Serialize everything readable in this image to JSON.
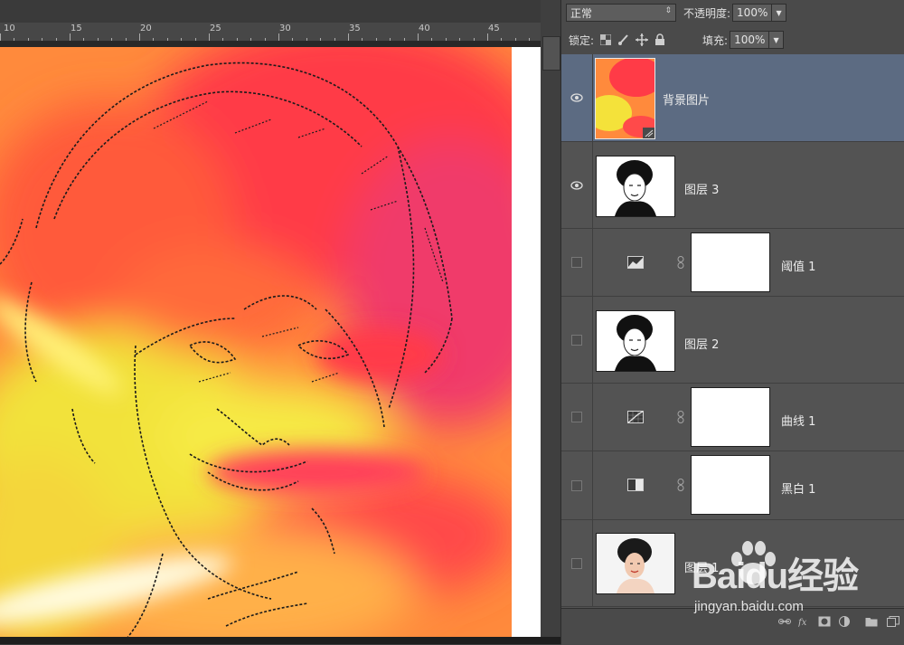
{
  "canvas": {
    "ruler_numbers": [
      "10",
      "15",
      "20",
      "25",
      "30",
      "35",
      "40",
      "45"
    ]
  },
  "layers_panel": {
    "blend_mode": "正常",
    "opacity_label": "不透明度:",
    "opacity_value": "100%",
    "lock_label": "锁定:",
    "fill_label": "填充:",
    "fill_value": "100%",
    "layers": [
      {
        "name": "背景图片",
        "visible": true,
        "selected": true,
        "kind": "image"
      },
      {
        "name": "图层 3",
        "visible": true,
        "selected": false,
        "kind": "portrait-bw"
      },
      {
        "name": "阈值 1",
        "visible": false,
        "selected": false,
        "kind": "threshold-adjustment"
      },
      {
        "name": "图层 2",
        "visible": false,
        "selected": false,
        "kind": "portrait-bw"
      },
      {
        "name": "曲线 1",
        "visible": false,
        "selected": false,
        "kind": "curves-adjustment"
      },
      {
        "name": "黑白 1",
        "visible": false,
        "selected": false,
        "kind": "black-white-adjustment"
      },
      {
        "name": "图层 1",
        "visible": false,
        "selected": false,
        "kind": "portrait-color"
      }
    ]
  },
  "watermark": {
    "brand": "Baidu经验",
    "url": "jingyan.baidu.com"
  },
  "colors": {
    "selected_row": "#5c6b82",
    "panel_bg": "#535353",
    "art_red": "#ff3a4a",
    "art_yellow": "#f5e32a",
    "art_orange": "#ff9a3c"
  }
}
